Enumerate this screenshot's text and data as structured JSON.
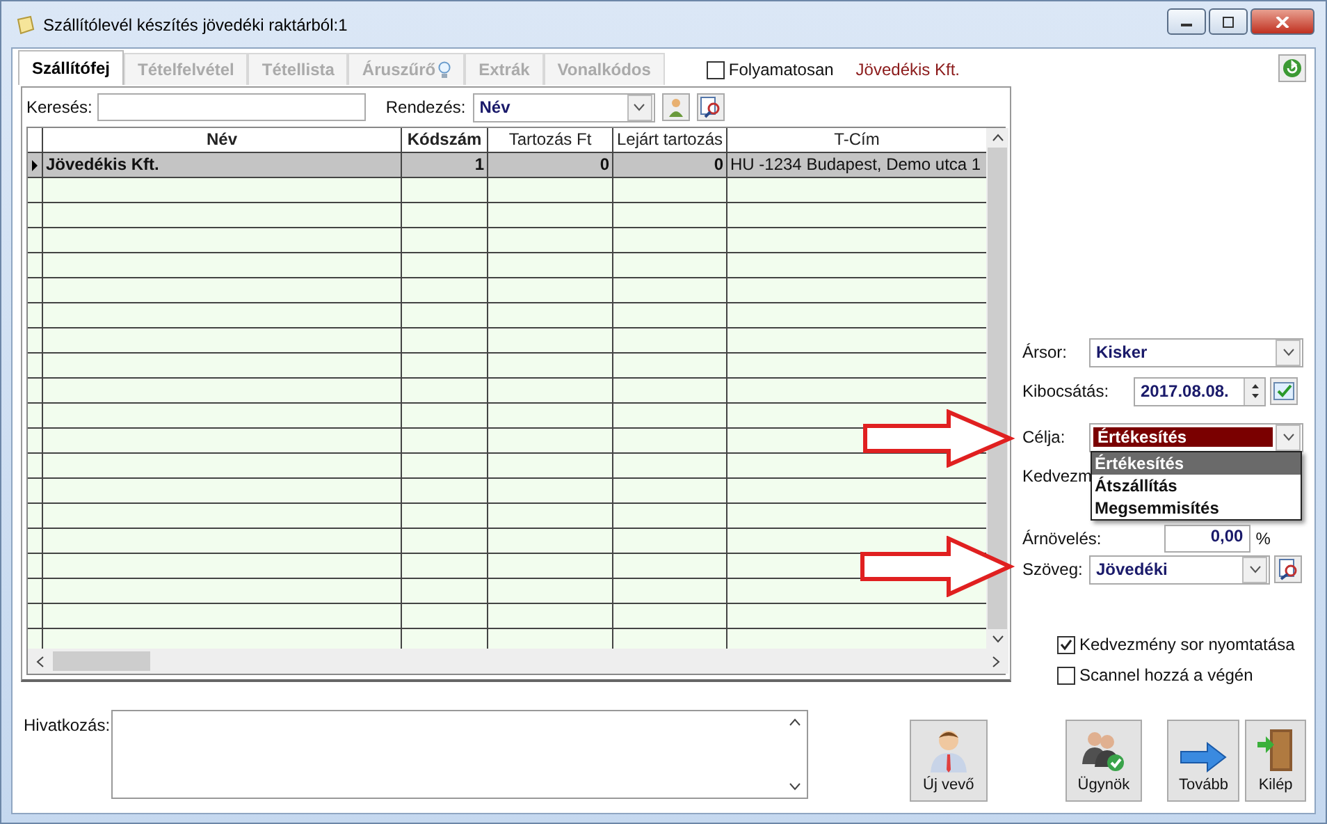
{
  "window": {
    "title": "Szállítólevél készítés jövedéki raktárból:1"
  },
  "tabs": [
    {
      "label": "Szállítófej",
      "selected": true,
      "bulb": false
    },
    {
      "label": "Tételfelvétel",
      "selected": false,
      "bulb": false
    },
    {
      "label": "Tétellista",
      "selected": false,
      "bulb": false
    },
    {
      "label": "Áruszűrő",
      "selected": false,
      "bulb": true
    },
    {
      "label": "Extrák",
      "selected": false,
      "bulb": false
    },
    {
      "label": "Vonalkódos",
      "selected": false,
      "bulb": false
    }
  ],
  "continuous": {
    "label": "Folyamatosan",
    "checked": false
  },
  "company": "Jövedékis Kft.",
  "search": {
    "label": "Keresés:"
  },
  "sort": {
    "label": "Rendezés:",
    "value": "Név"
  },
  "table": {
    "columns": [
      "Név",
      "Kódszám",
      "Tartozás Ft",
      "Lejárt tartozás",
      "T-Cím"
    ],
    "rows": [
      {
        "cells": [
          "Jövedékis Kft.",
          "1",
          "0",
          "0",
          "HU -1234 Budapest, Demo utca 1"
        ],
        "selected": true
      }
    ]
  },
  "form": {
    "price_list": {
      "label": "Ársor:",
      "value": "Kisker"
    },
    "issue_date": {
      "label": "Kibocsátás:",
      "value": "2017.08.08."
    },
    "purpose": {
      "label": "Célja:",
      "value": "Értékesítés",
      "options": [
        {
          "label": "Értékesítés",
          "selected": true
        },
        {
          "label": "Átszállítás",
          "selected": false
        },
        {
          "label": "Megsemmisítés",
          "selected": false
        }
      ]
    },
    "discount": {
      "label": "Kedvezm"
    },
    "markup": {
      "label": "Árnövelés:",
      "value": "0,00",
      "unit": "%"
    },
    "text": {
      "label": "Szöveg:",
      "value": "Jövedéki"
    }
  },
  "checkboxes": [
    {
      "label": "Kedvezmény sor nyomtatása",
      "checked": true
    },
    {
      "label": "Scannel hozzá a végén",
      "checked": false
    }
  ],
  "reference": {
    "label": "Hivatkozás:"
  },
  "buttons": [
    {
      "label": "Új vevő",
      "kind": "new_customer"
    },
    {
      "label": "Ügynök",
      "kind": "agent"
    },
    {
      "label": "Tovább",
      "kind": "next"
    },
    {
      "label": "Kilép",
      "kind": "exit"
    }
  ]
}
